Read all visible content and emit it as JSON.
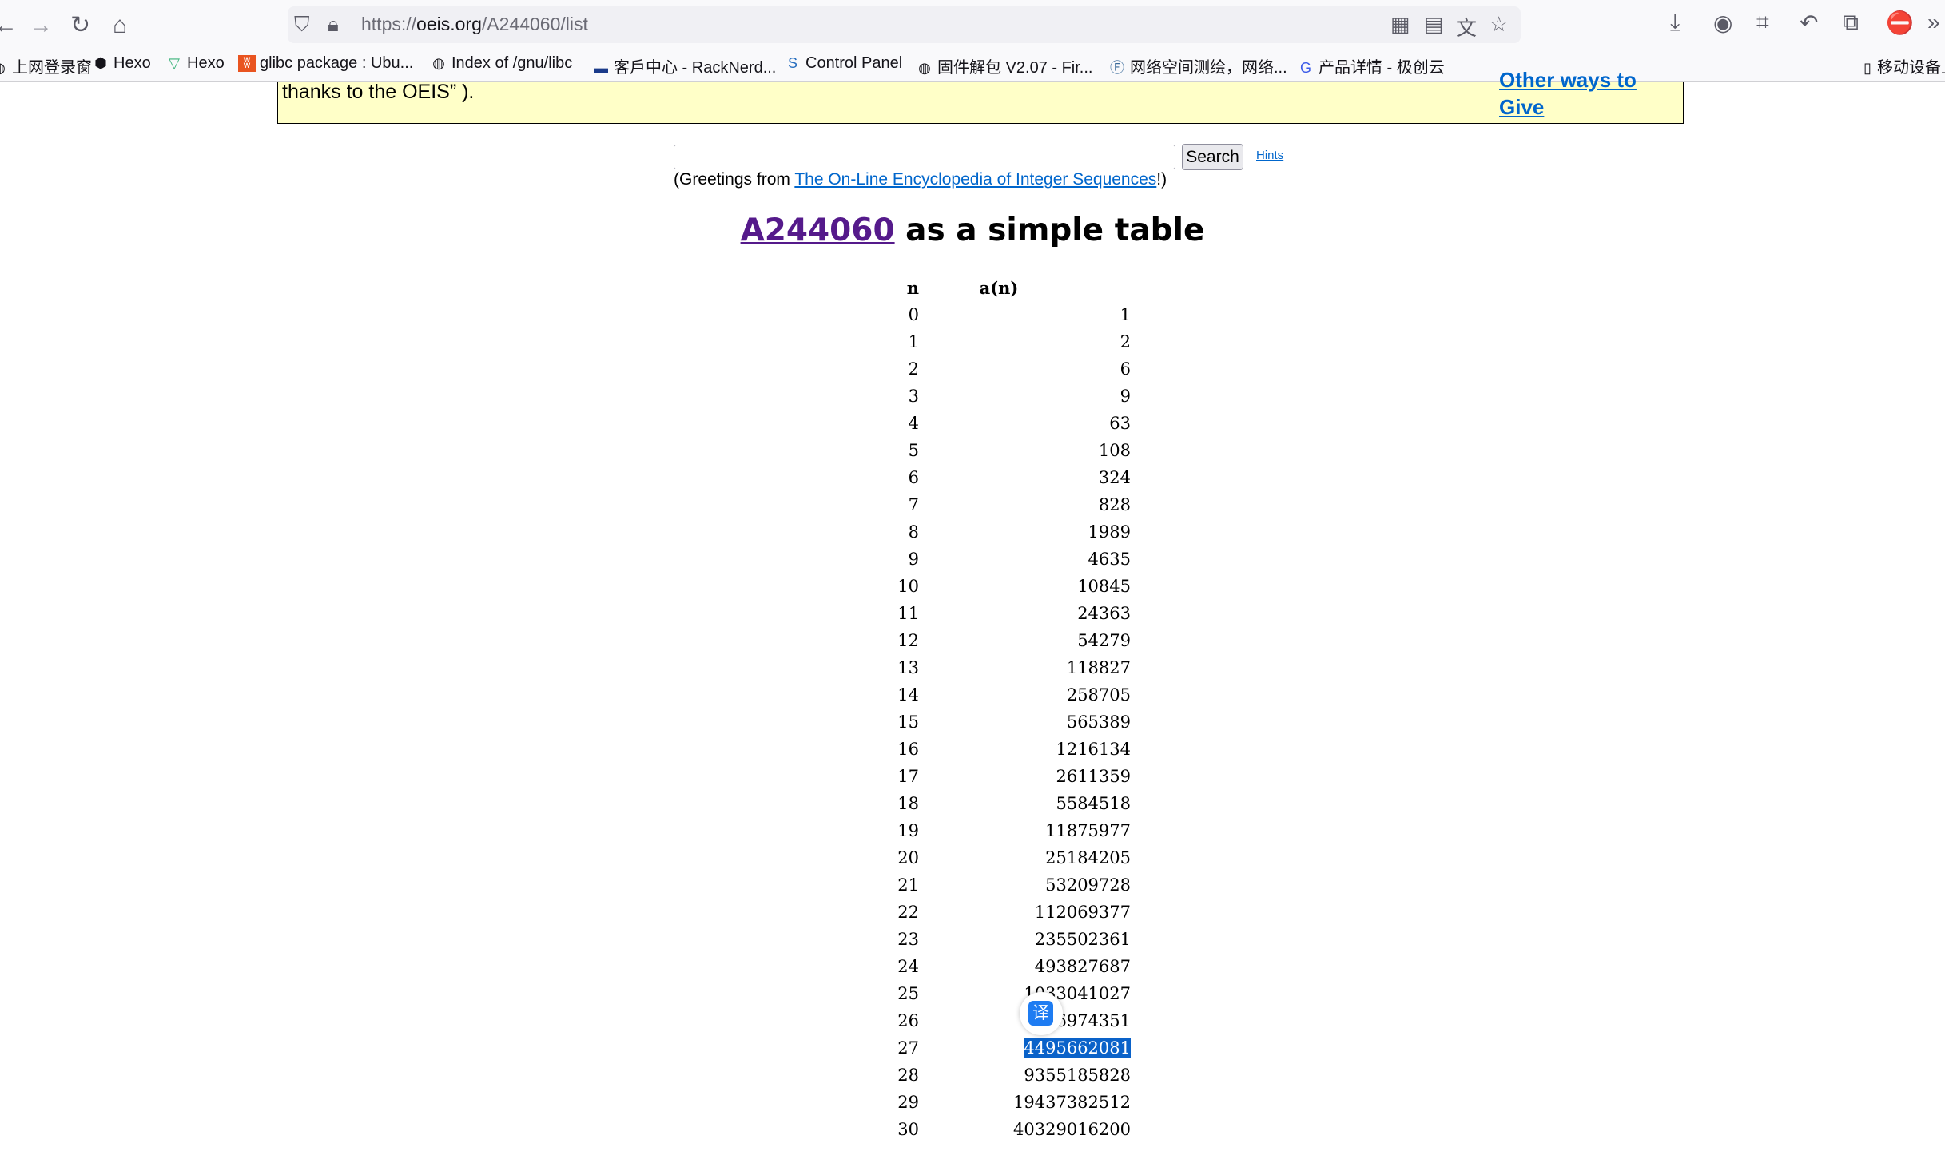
{
  "browser": {
    "url_prefix": "https://",
    "url_domain": "oeis.org",
    "url_path": "/A244060/list",
    "bookmarks": [
      {
        "label": "上网登录窗",
        "icon": "globe"
      },
      {
        "label": "Hexo",
        "icon": "hexo"
      },
      {
        "label": "Hexo",
        "icon": "fox"
      },
      {
        "label": "glibc package : Ubu...",
        "icon": "ubuntu"
      },
      {
        "label": "Index of /gnu/libc",
        "icon": "globe"
      },
      {
        "label": "客戶中心 - RackNerd...",
        "icon": "racknerd"
      },
      {
        "label": "Control Panel",
        "icon": "panel"
      },
      {
        "label": "固件解包 V2.07 - Fir...",
        "icon": "globe"
      },
      {
        "label": "网络空间测绘，网络...",
        "icon": "fofa"
      },
      {
        "label": "产品详情 - 极创云",
        "icon": "cloud"
      },
      {
        "label": "移动设备上",
        "icon": "mobile"
      }
    ]
  },
  "banner": {
    "text": "thanks to the OEIS” ).",
    "link_line1": "Other ways to",
    "link_line2": "Give"
  },
  "search": {
    "value": "",
    "button": "Search",
    "hints": "Hints",
    "greet_prefix": "(Greetings from ",
    "greet_link": "The On-Line Encyclopedia of Integer Sequences",
    "greet_suffix": "!)"
  },
  "title": {
    "seq": "A244060",
    "rest": " as a simple table"
  },
  "table": {
    "headers": [
      "n",
      "a(n)"
    ],
    "rows": [
      [
        "0",
        "1"
      ],
      [
        "1",
        "2"
      ],
      [
        "2",
        "6"
      ],
      [
        "3",
        "9"
      ],
      [
        "4",
        "63"
      ],
      [
        "5",
        "108"
      ],
      [
        "6",
        "324"
      ],
      [
        "7",
        "828"
      ],
      [
        "8",
        "1989"
      ],
      [
        "9",
        "4635"
      ],
      [
        "10",
        "10845"
      ],
      [
        "11",
        "24363"
      ],
      [
        "12",
        "54279"
      ],
      [
        "13",
        "118827"
      ],
      [
        "14",
        "258705"
      ],
      [
        "15",
        "565389"
      ],
      [
        "16",
        "1216134"
      ],
      [
        "17",
        "2611359"
      ],
      [
        "18",
        "5584518"
      ],
      [
        "19",
        "11875977"
      ],
      [
        "20",
        "25184205"
      ],
      [
        "21",
        "53209728"
      ],
      [
        "22",
        "112069377"
      ],
      [
        "23",
        "235502361"
      ],
      [
        "24",
        "493827687"
      ],
      [
        "25",
        "1033041027"
      ],
      [
        "26",
        "2156974351"
      ],
      [
        "27",
        "4495662081"
      ],
      [
        "28",
        "9355185828"
      ],
      [
        "29",
        "19437382512"
      ],
      [
        "30",
        "40329016200"
      ]
    ],
    "selected_row": 27
  },
  "translate_icon": "译"
}
